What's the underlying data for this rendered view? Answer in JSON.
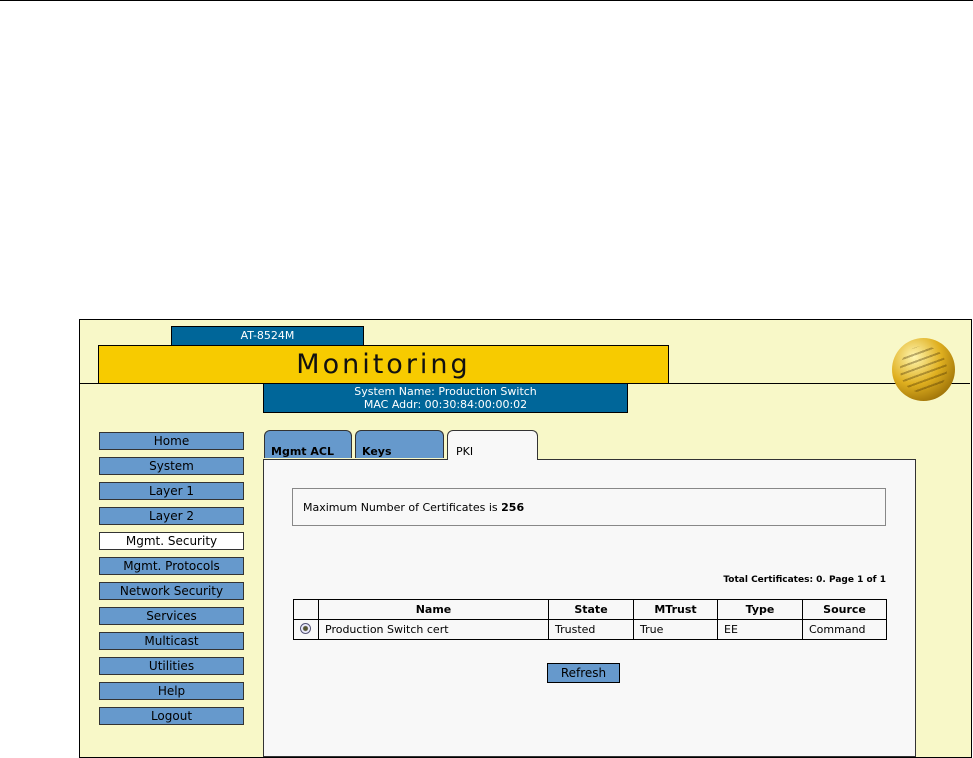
{
  "header": {
    "model": "AT-8524M",
    "title": "Monitoring",
    "system_name": "System Name: Production Switch",
    "mac_addr": "MAC Addr: 00:30:84:00:00:02"
  },
  "nav": [
    "Home",
    "System",
    "Layer 1",
    "Layer 2",
    "Mgmt. Security",
    "Mgmt. Protocols",
    "Network Security",
    "Services",
    "Multicast",
    "Utilities",
    "Help",
    "Logout"
  ],
  "nav_active": "Mgmt. Security",
  "tabs": [
    "Mgmt ACL",
    "Keys",
    "PKI"
  ],
  "max_certs": {
    "label": "Maximum Number of Certificates is",
    "value": "256"
  },
  "total_text": "Total Certificates: 0. Page 1 of 1",
  "table": {
    "headers": [
      "",
      "Name",
      "State",
      "MTrust",
      "Type",
      "Source"
    ],
    "rows": [
      {
        "name": "Production Switch cert",
        "state": "Trusted",
        "mtrust": "True",
        "type": "EE",
        "source": "Command"
      }
    ]
  },
  "refresh_label": "Refresh"
}
